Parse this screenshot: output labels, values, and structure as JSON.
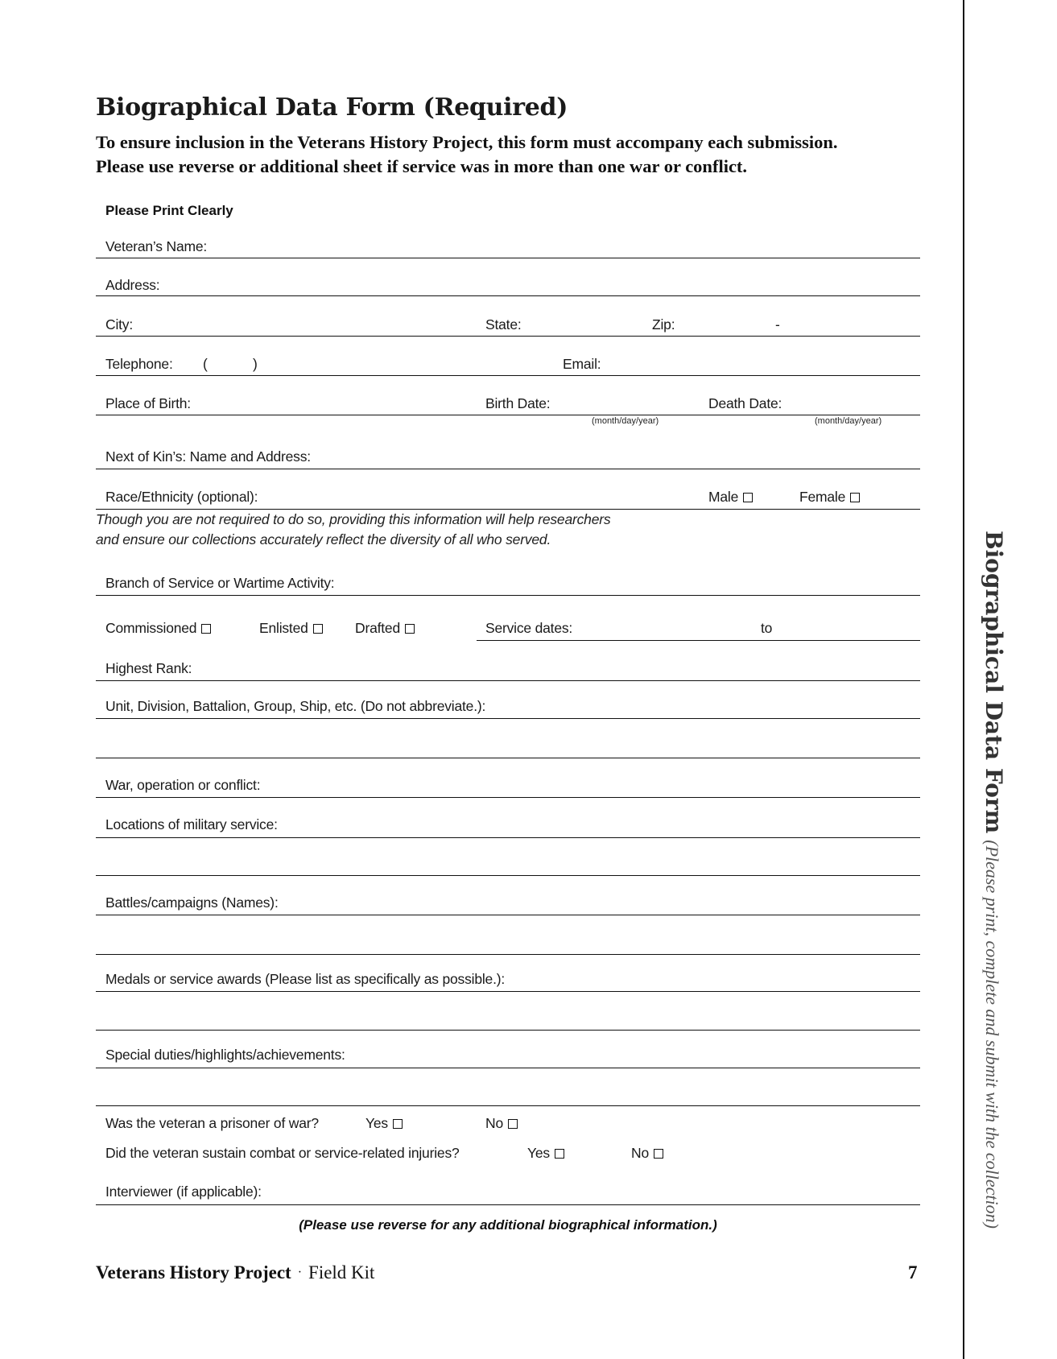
{
  "header": {
    "title": "Biographical Data Form (Required)",
    "subtitle_line1": "To ensure inclusion in the Veterans History Project, this form must accompany each submission.",
    "subtitle_line2": "Please use reverse or additional sheet if service was in more than one war or conflict.",
    "print_clearly": "Please Print Clearly"
  },
  "fields": {
    "veterans_name": "Veteran’s Name:",
    "address": "Address:",
    "city": "City:",
    "state": "State:",
    "zip": "Zip:",
    "zip_dash": "-",
    "telephone": "Telephone:",
    "tel_open_paren": "(",
    "tel_close_paren": ")",
    "email": "Email:",
    "place_of_birth": "Place of Birth:",
    "birth_date": "Birth Date:",
    "birth_date_hint": "(month/day/year)",
    "death_date": "Death Date:",
    "death_date_hint": "(month/day/year)",
    "next_of_kin": "Next of Kin’s: Name and Address:",
    "race_ethnicity": "Race/Ethnicity (optional):",
    "male": "Male",
    "female": "Female",
    "diversity_note_line1": "Though you are not required to do so, providing this information will help researchers",
    "diversity_note_line2": "and ensure our collections accurately reflect the diversity of all who served.",
    "branch": "Branch of Service or Wartime Activity:",
    "commissioned": "Commissioned",
    "enlisted": "Enlisted",
    "drafted": "Drafted",
    "service_dates": "Service dates:",
    "service_dates_to": "to",
    "highest_rank": "Highest Rank:",
    "unit": "Unit, Division, Battalion, Group, Ship, etc. (Do not abbreviate.):",
    "war": "War, operation or conflict:",
    "locations": "Locations of military service:",
    "battles": "Battles/campaigns (Names):",
    "medals": "Medals or service awards (Please list as specifically as possible.):",
    "special_duties": "Special duties/highlights/achievements:",
    "pow_question": "Was the veteran a prisoner of war?",
    "pow_yes": "Yes",
    "pow_no": "No",
    "injury_question": "Did the veteran sustain combat or service-related injuries?",
    "injury_yes": "Yes",
    "injury_no": "No",
    "interviewer": "Interviewer (if applicable):"
  },
  "bottom_note": "(Please use reverse for any additional biographical information.)",
  "footer": {
    "project": "Veterans History Project",
    "separator": "·",
    "kit": "Field Kit",
    "page_number": "7"
  },
  "side_tab": {
    "bold": "Biographical Data Form",
    "italic": "(Please print, complete and submit with the collection)"
  }
}
